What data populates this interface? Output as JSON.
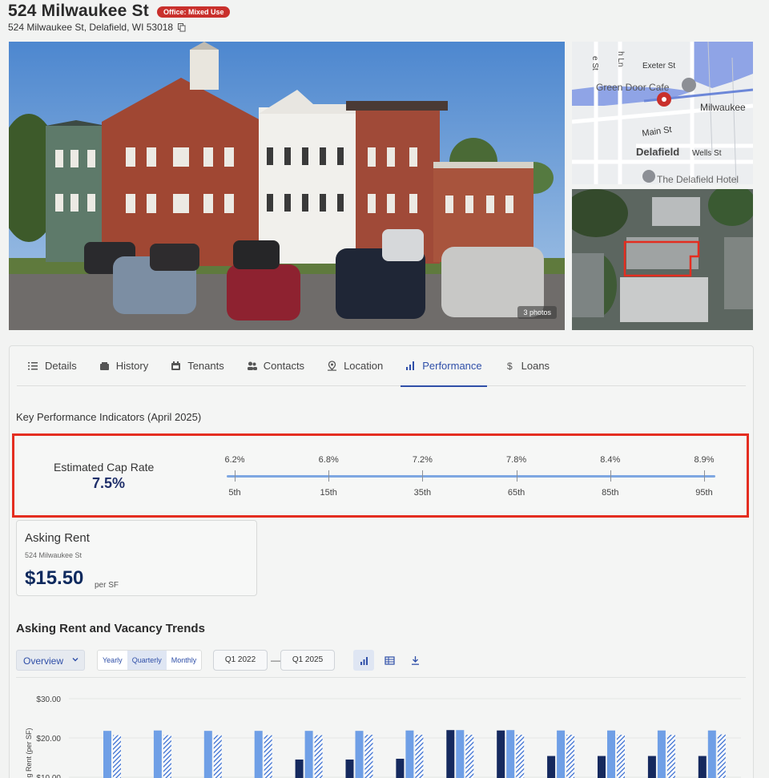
{
  "header": {
    "title": "524 Milwaukee St",
    "badge": "Office: Mixed Use",
    "address": "524 Milwaukee St, Delafield, WI 53018"
  },
  "photos": {
    "count_label": "3 photos"
  },
  "map": {
    "labels": [
      "Exeter St",
      "Green Door Cafe",
      "Milwaukee",
      "Main St",
      "Delafield",
      "Wells St",
      "The Delafield Hotel",
      "e St",
      "h Ln"
    ]
  },
  "tabs": [
    {
      "label": "Details",
      "icon": "list-icon"
    },
    {
      "label": "History",
      "icon": "history-icon"
    },
    {
      "label": "Tenants",
      "icon": "tenants-icon"
    },
    {
      "label": "Contacts",
      "icon": "contacts-icon"
    },
    {
      "label": "Location",
      "icon": "location-pin-icon"
    },
    {
      "label": "Performance",
      "icon": "bar-chart-icon",
      "active": true
    },
    {
      "label": "Loans",
      "icon": "dollar-icon"
    }
  ],
  "kpi": {
    "heading": "Key Performance Indicators (April 2025)",
    "cap_label": "Estimated Cap Rate",
    "cap_value": "7.5%",
    "ticks": [
      {
        "value": "6.2%",
        "pct": "5th"
      },
      {
        "value": "6.8%",
        "pct": "15th"
      },
      {
        "value": "7.2%",
        "pct": "35th"
      },
      {
        "value": "7.8%",
        "pct": "65th"
      },
      {
        "value": "8.4%",
        "pct": "85th"
      },
      {
        "value": "8.9%",
        "pct": "95th"
      }
    ],
    "highlight_color": "#e42d20"
  },
  "asking_rent": {
    "title": "Asking Rent",
    "subtitle": "524 Milwaukee St",
    "value": "$15.50",
    "unit": "per SF"
  },
  "trends": {
    "title": "Asking Rent and Vacancy Trends",
    "view_select": "Overview",
    "periods": [
      "Yearly",
      "Quarterly",
      "Monthly"
    ],
    "active_period": "Quarterly",
    "date_from": "Q1 2022",
    "date_to": "Q1 2025",
    "date_separator": "—"
  },
  "chart_data": {
    "type": "bar",
    "ylabel": "ng Rent (per SF)",
    "yticks": [
      "$30.00",
      "$20.00",
      "$10.00"
    ],
    "ylim": [
      10,
      30
    ],
    "groups": 13,
    "series": [
      {
        "values": [
          null,
          null,
          null,
          null,
          14.5,
          14.5,
          14.7,
          22.0,
          21.9,
          15.4,
          15.4,
          15.4,
          15.4
        ],
        "color": "#15295e"
      },
      {
        "values": [
          21.8,
          21.9,
          21.8,
          21.8,
          21.8,
          21.8,
          21.9,
          22.0,
          22.0,
          21.9,
          21.9,
          21.9,
          21.9
        ],
        "color": "#6f9fe6"
      },
      {
        "values": [
          20.7,
          20.7,
          20.7,
          20.7,
          20.7,
          20.8,
          20.8,
          20.8,
          20.8,
          20.8,
          20.8,
          20.8,
          20.9
        ],
        "color": "#3a6fd1",
        "pattern": "hatched"
      }
    ]
  }
}
